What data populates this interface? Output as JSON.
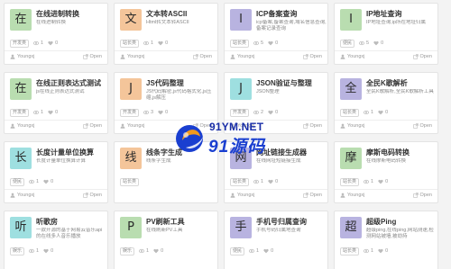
{
  "colors": {
    "green": "#b9ddb0",
    "orange": "#f4c59a",
    "violet": "#b8b3e0",
    "cyan": "#9edfe0",
    "watermark_blue": "#1a3fd0",
    "watermark_orange": "#f39a1e"
  },
  "cards": [
    {
      "char": "在",
      "color": "#b9ddb0",
      "title": "在线进制转换",
      "desc": "在线进制转换",
      "tag": "开发类",
      "views": "1",
      "likes": "0",
      "author": "Youngxj",
      "action": "Open"
    },
    {
      "char": "文",
      "color": "#f4c59a",
      "title": "文本转ASCII",
      "desc": "Html转文本转ASCII",
      "tag": "站长类",
      "views": "1",
      "likes": "0",
      "author": "Youngxj",
      "action": "Open"
    },
    {
      "char": "I",
      "color": "#b8b3e0",
      "title": "ICP备案查询",
      "desc": "icp备案,备案查询,域名信息查询,备案记录查询",
      "tag": "站长类",
      "views": "5",
      "likes": "0",
      "author": "Youngxj",
      "action": "Open"
    },
    {
      "char": "I",
      "color": "#b9ddb0",
      "title": "IP地址查询",
      "desc": "IP地址查询,ip所在地址归属",
      "tag": "便民",
      "views": "5",
      "likes": "0",
      "author": "Youngxj",
      "action": "Open"
    },
    {
      "char": "在",
      "color": "#b9ddb0",
      "title": "在线正则表达式测试",
      "desc": "js在线正则表达式测试",
      "tag": "开发类",
      "views": "1",
      "likes": "0",
      "author": "Youngxj",
      "action": "Open"
    },
    {
      "char": "J",
      "color": "#f4c59a",
      "title": "JS代码整理",
      "desc": "JS代码解密,js代码格式化,js压缩,js解压",
      "tag": "开发类",
      "views": "3",
      "likes": "0",
      "author": "Youngxj",
      "action": "Open"
    },
    {
      "char": "J",
      "color": "#9edfe0",
      "title": "JSON验证与整理",
      "desc": "JSON整理",
      "tag": "开发类",
      "views": "2",
      "likes": "0",
      "author": "Youngxj",
      "action": "Open"
    },
    {
      "char": "全",
      "color": "#b8b3e0",
      "title": "全民K歌解析",
      "desc": "全民K歌解析,全民K歌解析工具",
      "tag": "站长类",
      "views": "1",
      "likes": "0",
      "author": "Youngxj",
      "action": "Open"
    },
    {
      "char": "长",
      "color": "#9edfe0",
      "title": "长度计量单位换算",
      "desc": "长度计量单位换算计算",
      "tag": "便民",
      "views": "1",
      "likes": "0",
      "author": "Youngxj",
      "action": "Open"
    },
    {
      "char": "线",
      "color": "#f4c59a",
      "title": "线条字生成",
      "desc": "线条字生成",
      "tag": "站长类",
      "views": "",
      "likes": "",
      "author": "",
      "action": ""
    },
    {
      "char": "网",
      "color": "#b8b3e0",
      "title": "网址链接生成器",
      "desc": "在线网址短链接生成",
      "tag": "站长类",
      "views": "1",
      "likes": "0",
      "author": "Youngxj",
      "action": "Open"
    },
    {
      "char": "摩",
      "color": "#b9ddb0",
      "title": "摩斯电码转换",
      "desc": "在线摩斯电码转换",
      "tag": "站长类",
      "views": "1",
      "likes": "0",
      "author": "Youngxj",
      "action": "Open"
    },
    {
      "char": "听",
      "color": "#9edfe0",
      "title": "听歌房",
      "desc": "一款开源的基于网易云音乐api的在线多人音乐播放",
      "tag": "娱乐",
      "views": "1",
      "likes": "0",
      "author": "",
      "action": ""
    },
    {
      "char": "P",
      "color": "#b9ddb0",
      "title": "PV刷新工具",
      "desc": "在线刷新PV工具",
      "tag": "娱乐",
      "views": "1",
      "likes": "0",
      "author": "",
      "action": ""
    },
    {
      "char": "手",
      "color": "#b8b3e0",
      "title": "手机号归属查询",
      "desc": "手机号码归属地查询",
      "tag": "便民",
      "views": "1",
      "likes": "0",
      "author": "",
      "action": ""
    },
    {
      "char": "超",
      "color": "#b8b3e0",
      "title": "超级Ping",
      "desc": "超级ping,在线ping,网站测速,检测网站被墙,被劫持",
      "tag": "站长类",
      "views": "1",
      "likes": "0",
      "author": "",
      "action": ""
    }
  ],
  "watermark": {
    "url": "91YM.NET",
    "cn": "91源码"
  }
}
